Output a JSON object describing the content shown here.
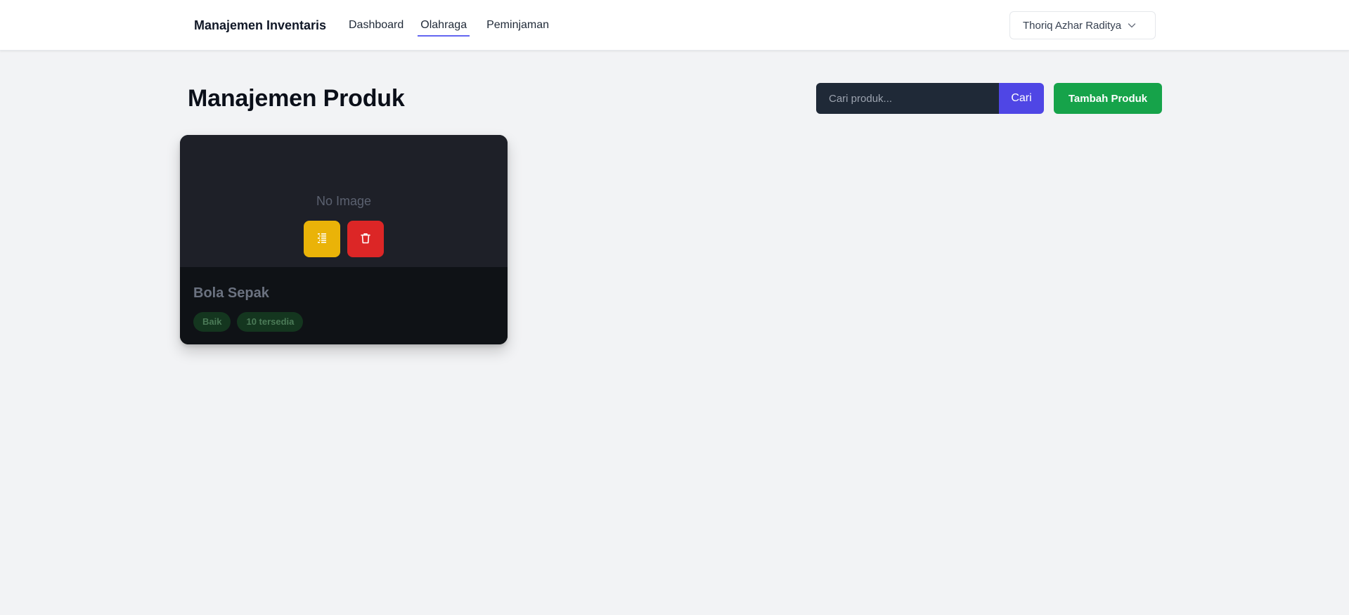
{
  "navbar": {
    "brand": "Manajemen Inventaris",
    "links": [
      {
        "label": "Dashboard",
        "active": false
      },
      {
        "label": "Olahraga",
        "active": true
      },
      {
        "label": "Peminjaman",
        "active": false
      }
    ],
    "user_name": "Thoriq Azhar Raditya",
    "user_menu_icon": "chevron-down-icon",
    "active_underline_color": "#6366f1"
  },
  "page": {
    "title": "Manajemen Produk",
    "search": {
      "placeholder": "Cari produk...",
      "value": "",
      "button_label": "Cari",
      "button_color": "#4f46e5"
    },
    "add_button_label": "Tambah Produk",
    "add_button_color": "#16a34a"
  },
  "products": [
    {
      "image_placeholder": "No Image",
      "name": "Bola Sepak",
      "condition": "Baik",
      "availability": "10 tersedia",
      "edit_icon": "edit-list-icon",
      "edit_color": "#eab308",
      "delete_icon": "trash-icon",
      "delete_color": "#dc2626"
    }
  ]
}
